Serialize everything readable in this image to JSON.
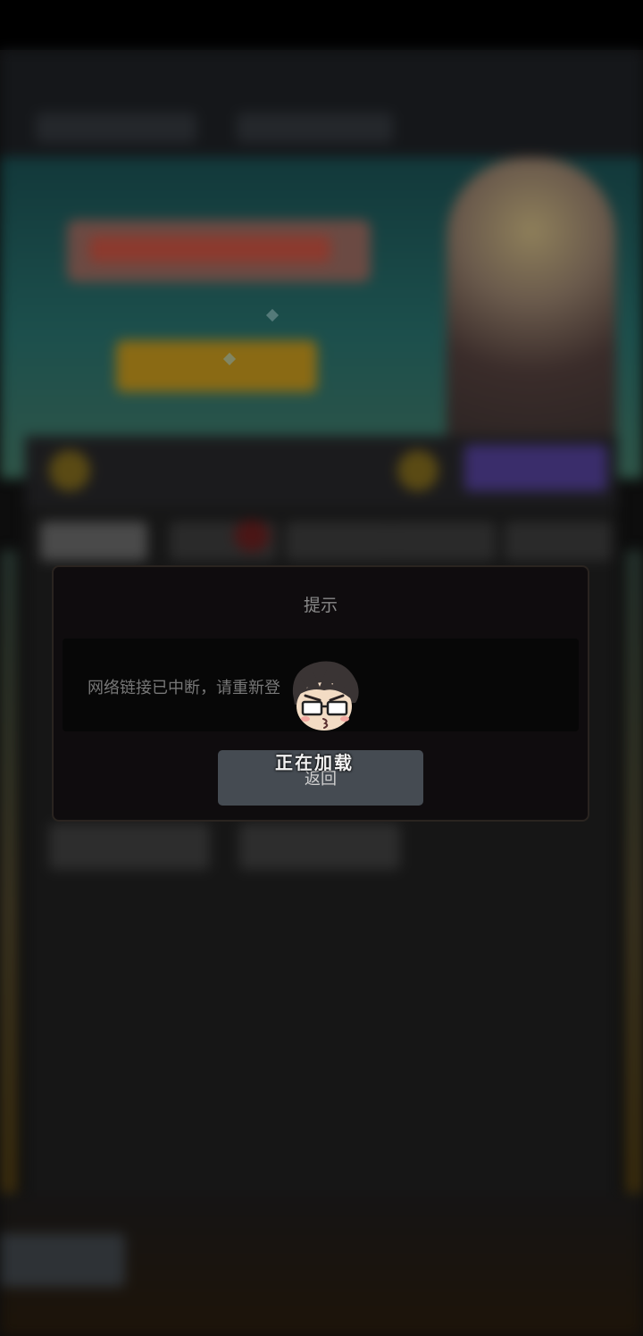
{
  "dialog": {
    "title": "提示",
    "message": "网络链接已中断，请重新登",
    "return_button_label": "返回"
  },
  "loading": {
    "text": "正在加载",
    "mascot_icon": "glasses-boy-mascot-icon"
  },
  "colors": {
    "dialog_background": "#0f0c0e",
    "button_background": "#454b52",
    "overlay_background": "#0d0d0d"
  }
}
